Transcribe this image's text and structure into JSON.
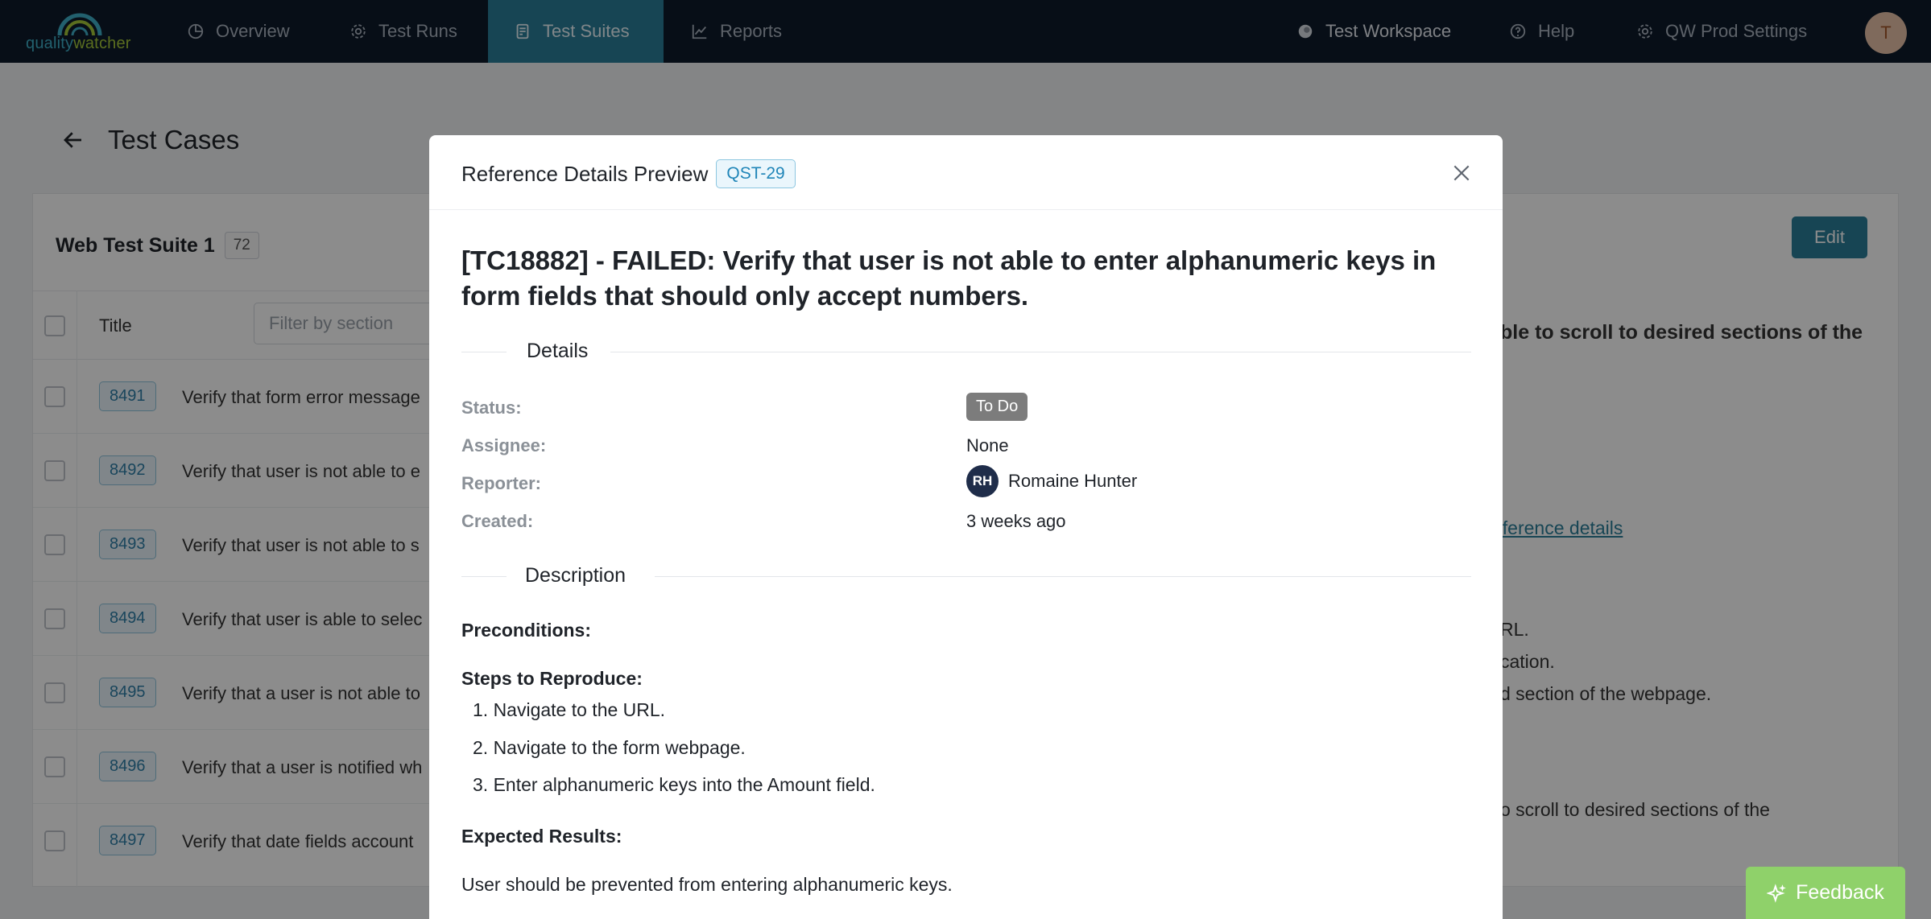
{
  "brand": {
    "part1": "quality",
    "part2": "watcher"
  },
  "nav": {
    "items": [
      {
        "label": "Overview"
      },
      {
        "label": "Test Runs"
      },
      {
        "label": "Test Suites"
      },
      {
        "label": "Reports"
      }
    ],
    "right": [
      {
        "label": "Test Workspace"
      },
      {
        "label": "Help"
      },
      {
        "label": "QW Prod Settings"
      }
    ],
    "avatar_initial": "T"
  },
  "page": {
    "title": "Test Cases",
    "suite_name": "Web Test Suite 1",
    "suite_count": "72",
    "edit_label": "Edit",
    "column_title": "Title",
    "filter_placeholder": "Filter by section",
    "rows": [
      {
        "id": "8491",
        "title": "Verify that form error message"
      },
      {
        "id": "8492",
        "title": "Verify that user is not able to e"
      },
      {
        "id": "8493",
        "title": "Verify that user is not able to s"
      },
      {
        "id": "8494",
        "title": "Verify that user is able to selec"
      },
      {
        "id": "8495",
        "title": "Verify that a user is not able to"
      },
      {
        "id": "8496",
        "title": "Verify that a user is notified wh"
      },
      {
        "id": "8497",
        "title": "Verify that date fields account"
      }
    ],
    "right_snippets": {
      "heading": "ble to scroll to desired sections of the",
      "link": "eference details",
      "line1": "RL.",
      "line2": "cation.",
      "line3": "d section of the webpage.",
      "line4": "o scroll to desired sections of the"
    }
  },
  "modal": {
    "title": "Reference Details Preview",
    "ref_badge": "QST-29",
    "case_title": "[TC18882] - FAILED: Verify that user is not able to enter alphanumeric keys in form fields that should only accept numbers.",
    "details_heading": "Details",
    "fields": {
      "status_label": "Status:",
      "status_value": "To Do",
      "assignee_label": "Assignee:",
      "assignee_value": "None",
      "reporter_label": "Reporter:",
      "reporter_initials": "RH",
      "reporter_name": "Romaine Hunter",
      "created_label": "Created:",
      "created_value": "3 weeks ago"
    },
    "description_heading": "Description",
    "preconditions_label": "Preconditions:",
    "steps_label": "Steps to Reproduce:",
    "steps": [
      "1. Navigate to the URL.",
      "2. Navigate to the form webpage.",
      "3. Enter alphanumeric keys into the Amount field."
    ],
    "expected_label": "Expected Results:",
    "expected_text": "User should be prevented from entering alphanumeric keys."
  },
  "feedback_label": "Feedback",
  "colors": {
    "nav_bg": "#0d1b2a",
    "accent": "#2a7f9a",
    "feedback": "#8fd16a",
    "status_pill": "#7c7c7c"
  }
}
